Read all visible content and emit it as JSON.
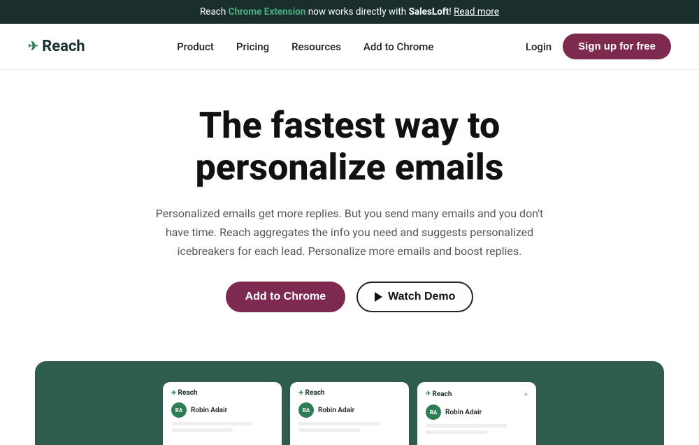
{
  "banner": {
    "pre_text": "Reach ",
    "bold_green": "Chrome Extension",
    "mid_text": " now works directly with ",
    "bold_white": "SalesLoft",
    "post_text": "! ",
    "read_more": "Read more"
  },
  "navbar": {
    "logo_text": "Reach",
    "nav_links": [
      {
        "label": "Product",
        "id": "product"
      },
      {
        "label": "Pricing",
        "id": "pricing"
      },
      {
        "label": "Resources",
        "id": "resources"
      },
      {
        "label": "Add to Chrome",
        "id": "add-to-chrome"
      }
    ],
    "login_label": "Login",
    "signup_label": "Sign up for free"
  },
  "hero": {
    "title": "The fastest way to personalize emails",
    "subtitle": "Personalized emails get more replies. But you send many emails and you don't have time. Reach aggregates the info you need and suggests personalized icebreakers for each lead. Personalize more emails and boost replies.",
    "add_chrome_label": "Add to Chrome",
    "watch_demo_label": "Watch Demo"
  },
  "demo_cards": [
    {
      "name": "Robin Adair",
      "logo": "Reach"
    },
    {
      "name": "Robin Adair",
      "logo": "Reach"
    },
    {
      "name": "Robin Adair",
      "logo": "Reach"
    }
  ]
}
